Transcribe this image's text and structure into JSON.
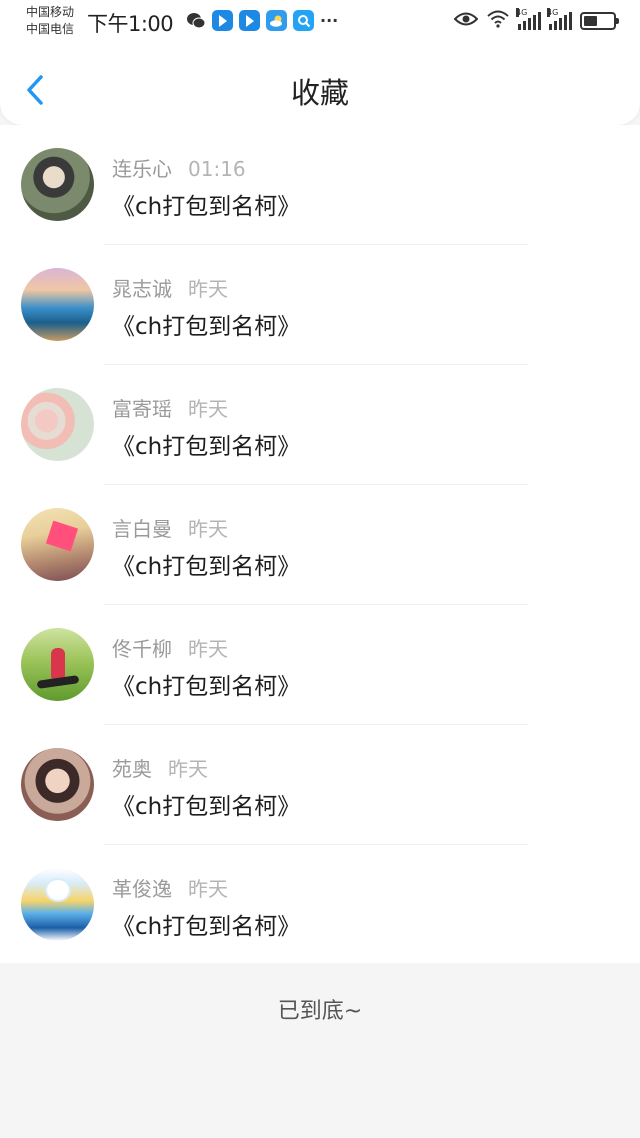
{
  "status": {
    "carrier1": "中国移动",
    "carrier2": "中国电信",
    "time": "下午1:00",
    "network1": "4G",
    "network2": "4G",
    "battery_level": 0.45
  },
  "header": {
    "title": "收藏"
  },
  "items": [
    {
      "name": "连乐心",
      "time": "01:16",
      "text": "《ch打包到名柯》"
    },
    {
      "name": "晁志诚",
      "time": "昨天",
      "text": "《ch打包到名柯》"
    },
    {
      "name": "富寄瑶",
      "time": "昨天",
      "text": "《ch打包到名柯》"
    },
    {
      "name": "言白曼",
      "time": "昨天",
      "text": "《ch打包到名柯》"
    },
    {
      "name": "佟千柳",
      "time": "昨天",
      "text": "《ch打包到名柯》"
    },
    {
      "name": "苑奥",
      "time": "昨天",
      "text": "《ch打包到名柯》"
    },
    {
      "name": "革俊逸",
      "time": "昨天",
      "text": "《ch打包到名柯》"
    }
  ],
  "footer": {
    "end_text": "已到底~"
  },
  "colors": {
    "accent": "#2196f3"
  }
}
